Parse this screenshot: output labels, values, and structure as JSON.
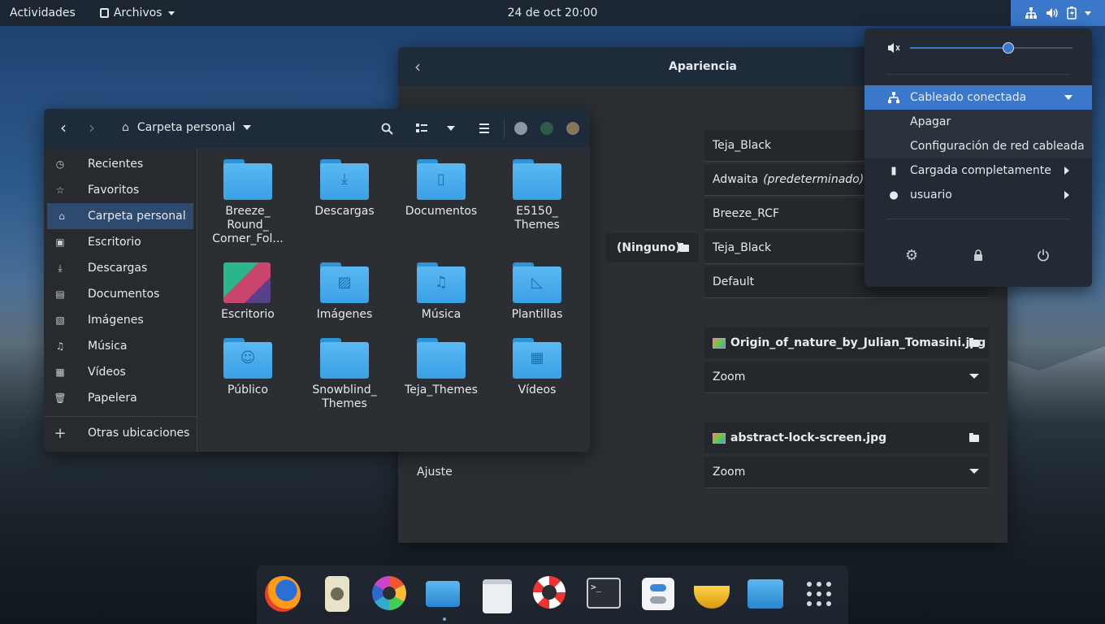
{
  "topbar": {
    "activities": "Actividades",
    "app_menu": "Archivos",
    "clock": "24 de oct  20:00"
  },
  "appearance": {
    "title": "Apariencia",
    "themes": [
      "Teja_Black",
      "Adwaita",
      "Breeze_RCF",
      "Teja_Black",
      "Default"
    ],
    "adwaita_suffix": "(predeterminado)",
    "none_label": "(Ninguno)",
    "background_file": "Origin_of_nature_by_Julian_Tomasini.jpg",
    "background_mode": "Zoom",
    "lock_file": "abstract-lock-screen.jpg",
    "lock_mode": "Zoom",
    "adjust_label": "Ajuste"
  },
  "files": {
    "location": "Carpeta personal",
    "sidebar": [
      {
        "label": "Recientes",
        "icon": "clock-icon",
        "glyph": "◷"
      },
      {
        "label": "Favoritos",
        "icon": "star-icon",
        "glyph": "☆"
      },
      {
        "label": "Carpeta personal",
        "icon": "home-icon",
        "glyph": "⌂"
      },
      {
        "label": "Escritorio",
        "icon": "desktop-icon",
        "glyph": "▣"
      },
      {
        "label": "Descargas",
        "icon": "download-icon",
        "glyph": "⤓"
      },
      {
        "label": "Documentos",
        "icon": "document-icon",
        "glyph": "▤"
      },
      {
        "label": "Imágenes",
        "icon": "image-icon",
        "glyph": "▧"
      },
      {
        "label": "Música",
        "icon": "music-icon",
        "glyph": "♫"
      },
      {
        "label": "Vídeos",
        "icon": "video-icon",
        "glyph": "▦"
      },
      {
        "label": "Papelera",
        "icon": "trash-icon",
        "glyph": "🗑"
      }
    ],
    "other_locations": "Otras ubicaciones",
    "items": [
      {
        "label": "Breeze_ Round_ Corner_Fol...",
        "glyph": ""
      },
      {
        "label": "Descargas",
        "glyph": "⤓"
      },
      {
        "label": "Documentos",
        "glyph": "▯"
      },
      {
        "label": "E5150_ Themes",
        "glyph": ""
      },
      {
        "label": "Escritorio",
        "glyph": ""
      },
      {
        "label": "Imágenes",
        "glyph": "▨"
      },
      {
        "label": "Música",
        "glyph": "♫"
      },
      {
        "label": "Plantillas",
        "glyph": "◺"
      },
      {
        "label": "Público",
        "glyph": "☺"
      },
      {
        "label": "Snowblind_ Themes",
        "glyph": ""
      },
      {
        "label": "Teja_Themes",
        "glyph": ""
      },
      {
        "label": "Vídeos",
        "glyph": "▦"
      }
    ]
  },
  "system_menu": {
    "network": "Cableado conectada",
    "turn_off": "Apagar",
    "wired_settings": "Configuración de red cableada",
    "battery": "Cargada completamente",
    "user": "usuario",
    "volume": 0.6
  },
  "dock": [
    "Firefox",
    "Rhythmbox",
    "Software",
    "Archivos",
    "Tienda",
    "Ayuda",
    "Terminal",
    "Ajustes",
    "Genie",
    "Papelera",
    "Aplicaciones"
  ]
}
